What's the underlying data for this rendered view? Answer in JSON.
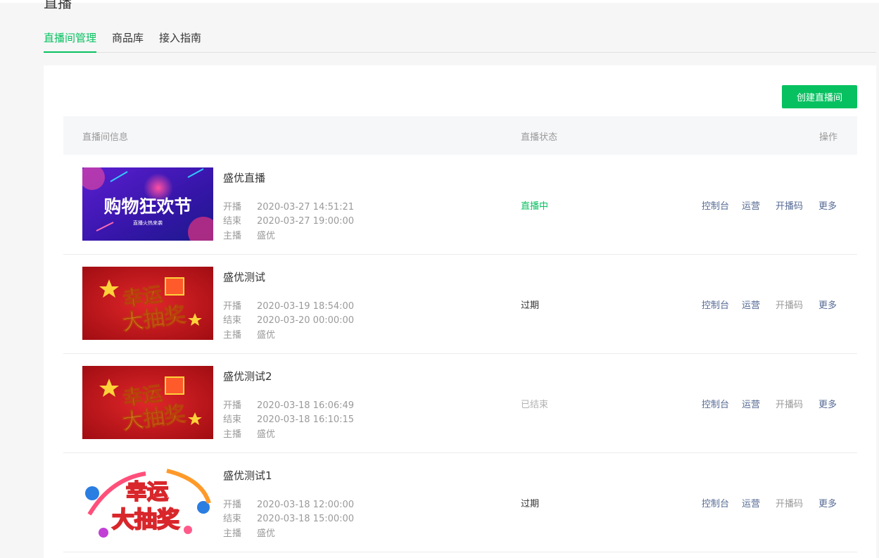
{
  "page": {
    "title": "直播"
  },
  "tabs": [
    {
      "label": "直播间管理",
      "active": true
    },
    {
      "label": "商品库",
      "active": false
    },
    {
      "label": "接入指南",
      "active": false
    }
  ],
  "toolbar": {
    "create_label": "创建直播间"
  },
  "table": {
    "headers": {
      "info": "直播间信息",
      "status": "直播状态",
      "ops": "操作"
    }
  },
  "meta_labels": {
    "start": "开播",
    "end": "结束",
    "host": "主播"
  },
  "rows": [
    {
      "name": "盛优直播",
      "start": "2020-03-27 14:51:21",
      "end": "2020-03-27 19:00:00",
      "host": "盛优",
      "status": "直播中",
      "status_color": "#07c160",
      "poster_title": "购物狂欢节",
      "poster_subtitle": "直播火热来袭",
      "ops": [
        "控制台",
        "运营",
        "开播码",
        "更多"
      ],
      "op3_color": "#576b95"
    },
    {
      "name": "盛优测试",
      "start": "2020-03-19 18:54:00",
      "end": "2020-03-20 00:00:00",
      "host": "盛优",
      "status": "过期",
      "status_color": "#353535",
      "poster_title_line1": "幸运",
      "poster_title_line2": "大抽奖",
      "ops": [
        "控制台",
        "运营",
        "开播码",
        "更多"
      ],
      "op3_color": "#9a9a9a"
    },
    {
      "name": "盛优测试2",
      "start": "2020-03-18 16:06:49",
      "end": "2020-03-18 16:10:15",
      "host": "盛优",
      "status": "已结束",
      "status_color": "#b2b2b2",
      "poster_title_line1": "幸运",
      "poster_title_line2": "大抽奖",
      "ops": [
        "控制台",
        "运营",
        "开播码",
        "更多"
      ],
      "op3_color": "#9a9a9a"
    },
    {
      "name": "盛优测试1",
      "start": "2020-03-18 12:00:00",
      "end": "2020-03-18 15:00:00",
      "host": "盛优",
      "status": "过期",
      "status_color": "#353535",
      "poster_title_line1": "幸运",
      "poster_title_line2": "大抽奖",
      "ops": [
        "控制台",
        "运营",
        "开播码",
        "更多"
      ],
      "op3_color": "#9a9a9a"
    }
  ],
  "colors": {
    "accent": "#07c160",
    "link": "#576b95",
    "muted": "#9a9a9a"
  }
}
